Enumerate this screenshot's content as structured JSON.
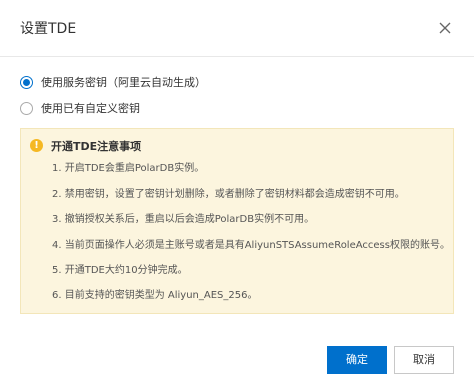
{
  "dialog": {
    "title": "设置TDE",
    "close_icon": "close-icon"
  },
  "options": [
    {
      "label": "使用服务密钥（阿里云自动生成）",
      "checked": true
    },
    {
      "label": "使用已有自定义密钥",
      "checked": false
    }
  ],
  "notice": {
    "icon": "warning-icon",
    "title": "开通TDE注意事项",
    "items": [
      "1. 开启TDE会重启PolarDB实例。",
      "2. 禁用密钥，设置了密钥计划删除，或者删除了密钥材料都会造成密钥不可用。",
      "3. 撤销授权关系后，重启以后会造成PolarDB实例不可用。",
      "4. 当前页面操作人必须是主账号或者是具有AliyunSTSAssumeRoleAccess权限的账号。",
      "5. 开通TDE大约10分钟完成。",
      "6. 目前支持的密钥类型为 Aliyun_AES_256。"
    ]
  },
  "buttons": {
    "ok": "确定",
    "cancel": "取消"
  },
  "colors": {
    "primary": "#0070cc",
    "notice_bg": "#fcf5de",
    "notice_border": "#f3e6b9",
    "warning": "#f5b823"
  }
}
